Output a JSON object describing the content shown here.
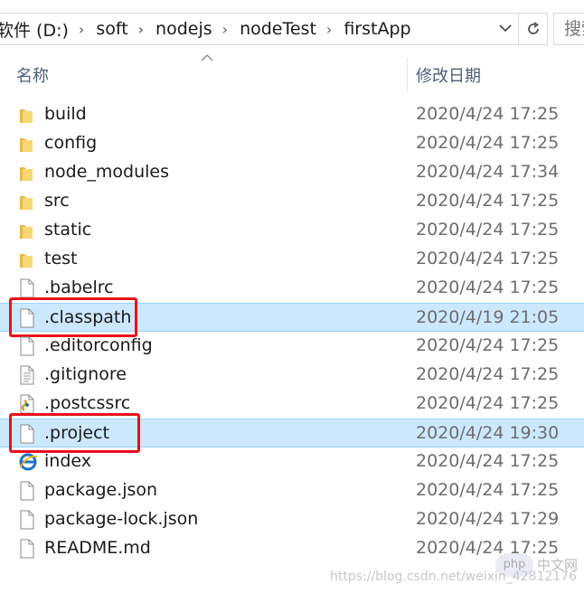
{
  "address": {
    "crumbs": [
      "软件 (D:)",
      "soft",
      "nodejs",
      "nodeTest",
      "firstApp"
    ],
    "separator": "›",
    "refresh_icon": "refresh-icon",
    "search_placeholder": "搜索"
  },
  "columns": {
    "name": "名称",
    "date": "修改日期"
  },
  "files": [
    {
      "name": "build",
      "date": "2020/4/24 17:25",
      "type": "folder"
    },
    {
      "name": "config",
      "date": "2020/4/24 17:25",
      "type": "folder"
    },
    {
      "name": "node_modules",
      "date": "2020/4/24 17:34",
      "type": "folder"
    },
    {
      "name": "src",
      "date": "2020/4/24 17:25",
      "type": "folder"
    },
    {
      "name": "static",
      "date": "2020/4/24 17:25",
      "type": "folder"
    },
    {
      "name": "test",
      "date": "2020/4/24 17:25",
      "type": "folder"
    },
    {
      "name": ".babelrc",
      "date": "2020/4/24 17:25",
      "type": "file"
    },
    {
      "name": ".classpath",
      "date": "2020/4/19 21:05",
      "type": "file",
      "selected": true,
      "highlighted": true
    },
    {
      "name": ".editorconfig",
      "date": "2020/4/24 17:25",
      "type": "file"
    },
    {
      "name": ".gitignore",
      "date": "2020/4/24 17:25",
      "type": "text-file"
    },
    {
      "name": ".postcssrc",
      "date": "2020/4/24 17:25",
      "type": "script-file"
    },
    {
      "name": ".project",
      "date": "2020/4/24 19:30",
      "type": "file",
      "selected": true,
      "highlighted": true
    },
    {
      "name": "index",
      "date": "2020/4/24 17:25",
      "type": "html-file"
    },
    {
      "name": "package.json",
      "date": "2020/4/24 17:25",
      "type": "file"
    },
    {
      "name": "package-lock.json",
      "date": "2020/4/24 17:29",
      "type": "file"
    },
    {
      "name": "README.md",
      "date": "2020/4/24 17:25",
      "type": "file"
    }
  ],
  "colors": {
    "selection_bg": "#cce8ff",
    "selection_border": "#99d1ff",
    "highlight_box": "#e8101e",
    "folder": "#f8d775"
  },
  "watermark": {
    "url": "https://blog.csdn.net/weixin_42812176",
    "logo": "php",
    "cn": "中文网"
  }
}
